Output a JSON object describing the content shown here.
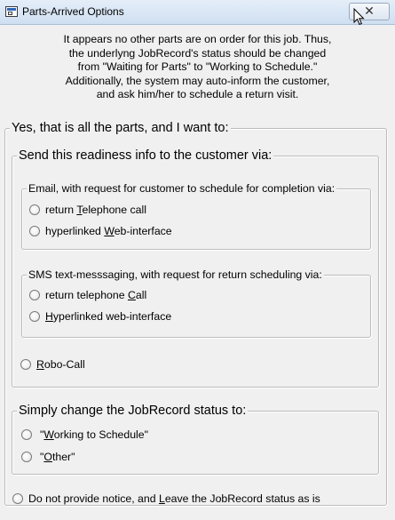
{
  "window": {
    "title": "Parts-Arrived Options",
    "close_glyph": "✕",
    "icon": "application-window-icon"
  },
  "intro_lines": [
    "It appears no other parts are on order for this job.  Thus,",
    "the underlyng JobRecord's status should be changed",
    "from \"Waiting for Parts\" to \"Working to Schedule.\"",
    "Additionally, the system may auto-inform the customer,",
    "and ask him/her to schedule a return visit."
  ],
  "groups": {
    "yes_all_parts": {
      "legend": "Yes, that is all the parts, and I want to:"
    },
    "send_info": {
      "legend": "Send this readiness info to the customer via:"
    },
    "email": {
      "legend": "Email, with request for customer to schedule for completion via:",
      "options": [
        {
          "pre": "return ",
          "hot": "T",
          "post": "elephone call"
        },
        {
          "pre": "hyperlinked ",
          "hot": "W",
          "post": "eb-interface"
        }
      ]
    },
    "sms": {
      "legend": "SMS text-messsaging, with request for return scheduling via:",
      "options": [
        {
          "pre": "return telephone ",
          "hot": "C",
          "post": "all"
        },
        {
          "pre": "",
          "hot": "H",
          "post": "yperlinked web-interface"
        }
      ]
    },
    "robo": {
      "pre": "",
      "hot": "R",
      "post": "obo-Call"
    },
    "change_status": {
      "legend": "Simply change the JobRecord status to:",
      "options": [
        {
          "pre": "\"",
          "hot": "W",
          "post": "orking to Schedule\""
        },
        {
          "pre": "\"",
          "hot": "O",
          "post": "ther\""
        }
      ]
    }
  },
  "no_notice": {
    "pre": "Do not provide notice, and ",
    "hot": "L",
    "post": "eave the JobRecord status as is"
  },
  "colors": {
    "window_bg": "#f0f0f0",
    "titlebar": "#d6e3f3",
    "group_border": "#bcbcbc"
  }
}
